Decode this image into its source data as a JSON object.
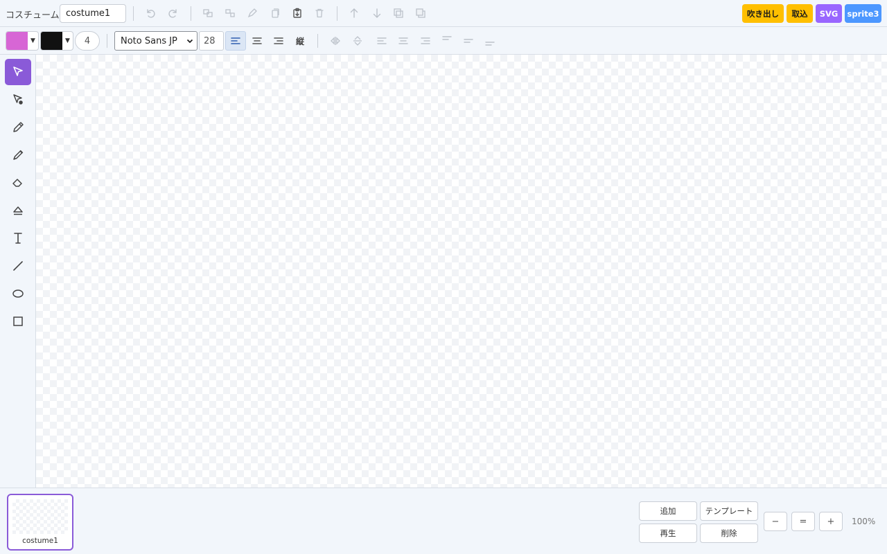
{
  "header": {
    "costume_label": "コスチューム",
    "costume_name": "costume1",
    "icons": [
      "undo-icon",
      "redo-icon",
      "group-icon",
      "ungroup-icon",
      "reshape-icon",
      "copy-icon",
      "paste-icon",
      "delete-icon",
      "bring-forward-icon",
      "send-backward-icon",
      "bring-to-front-icon",
      "send-to-back-icon"
    ],
    "actions": {
      "speech_bubble": "吹き出し",
      "import": "取込",
      "svg": "SVG",
      "sprite3": "sprite3"
    },
    "action_colors": {
      "speech_bubble": "#ffbf00",
      "import": "#ffbf00",
      "svg": "#9966ff",
      "sprite3": "#4c97ff"
    }
  },
  "properties": {
    "fill_color": "#d766d5",
    "stroke_color": "#111111",
    "stroke_width": "4",
    "font_family": "Noto Sans JP",
    "font_size": "28",
    "vertical_label": "縦",
    "icons": [
      "align-left-icon",
      "align-center-icon",
      "align-right-icon",
      "flip-horizontal-icon",
      "flip-vertical-icon",
      "align-items-left-icon",
      "align-items-center-icon",
      "align-items-right-icon",
      "align-items-top-icon",
      "align-items-middle-icon",
      "align-items-bottom-icon"
    ]
  },
  "tools": [
    "select-icon",
    "reshape-tool-icon",
    "pencil-icon",
    "brush-icon",
    "eraser-icon",
    "fill-icon",
    "text-icon",
    "line-icon",
    "ellipse-icon",
    "rectangle-icon"
  ],
  "costumes": [
    {
      "name": "costume1"
    }
  ],
  "footer": {
    "add": "追加",
    "template": "テンプレート",
    "play": "再生",
    "delete": "削除",
    "zoom_out": "−",
    "zoom_reset": "=",
    "zoom_in": "+",
    "zoom_level": "100%"
  }
}
